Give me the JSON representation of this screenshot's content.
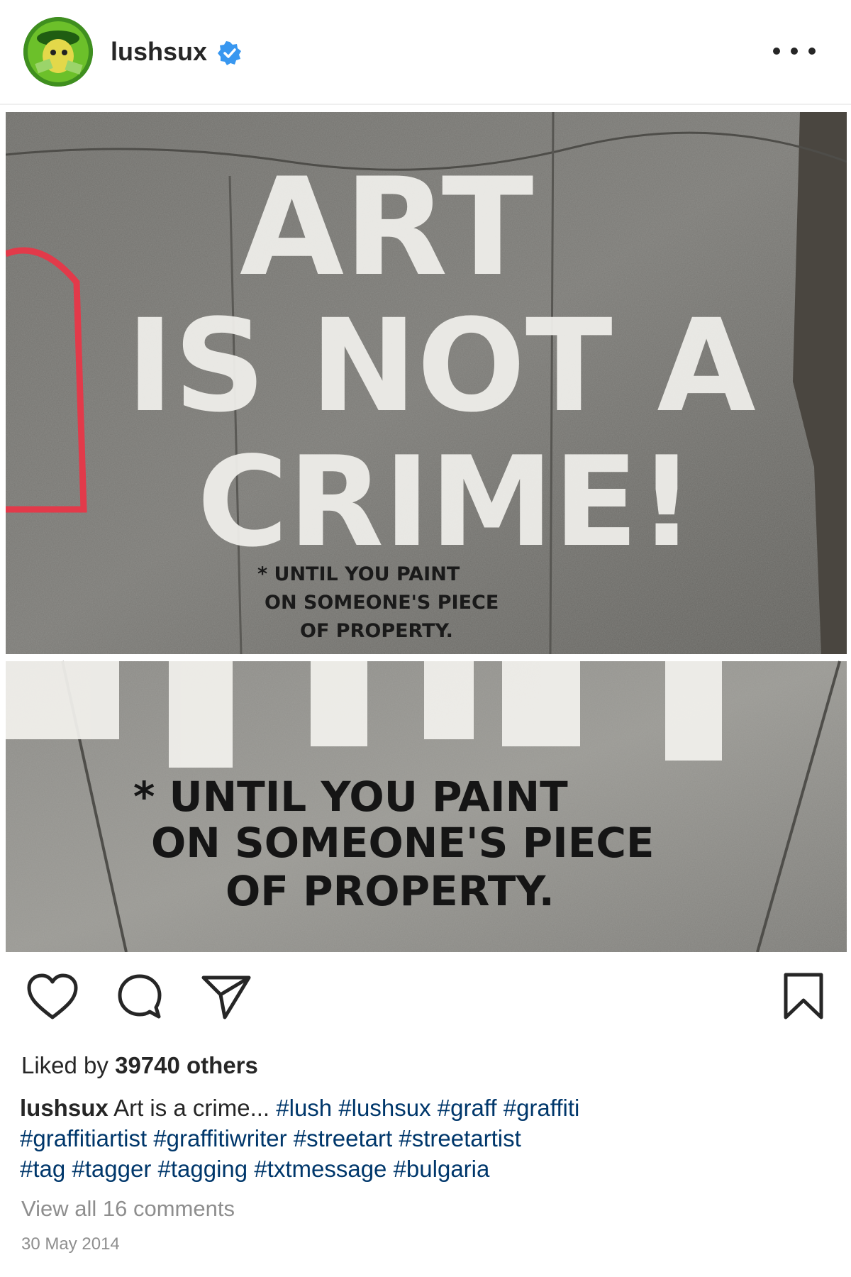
{
  "header": {
    "username": "lushsux",
    "verified": true,
    "more_icon": "more-horizontal-icon"
  },
  "post": {
    "image_text": {
      "line1": "ART",
      "line2": "IS NOT A",
      "line3": "CRIME!",
      "footnote": [
        "* UNTIL YOU PAINT",
        "ON SOMEONE'S PIECE",
        "OF PROPERTY."
      ]
    }
  },
  "actions": {
    "like_icon": "heart-icon",
    "comment_icon": "comment-icon",
    "share_icon": "paper-plane-icon",
    "save_icon": "bookmark-icon"
  },
  "likes": {
    "prefix": "Liked by ",
    "count_text": "39740 others"
  },
  "caption": {
    "username": "lushsux",
    "text": "Art is a crime...",
    "hashtags": [
      "#lush",
      "#lushsux",
      "#graff",
      "#graffiti",
      "#graffitiartist",
      "#graffitiwriter",
      "#streetart",
      "#streetartist",
      "#tag",
      "#tagger",
      "#tagging",
      "#txtmessage",
      "#bulgaria"
    ]
  },
  "comments": {
    "view_all": "View all 16 comments"
  },
  "date": "30 May 2014",
  "colors": {
    "link": "#00376b",
    "verified": "#3897f0",
    "muted": "#8e8e8e"
  }
}
